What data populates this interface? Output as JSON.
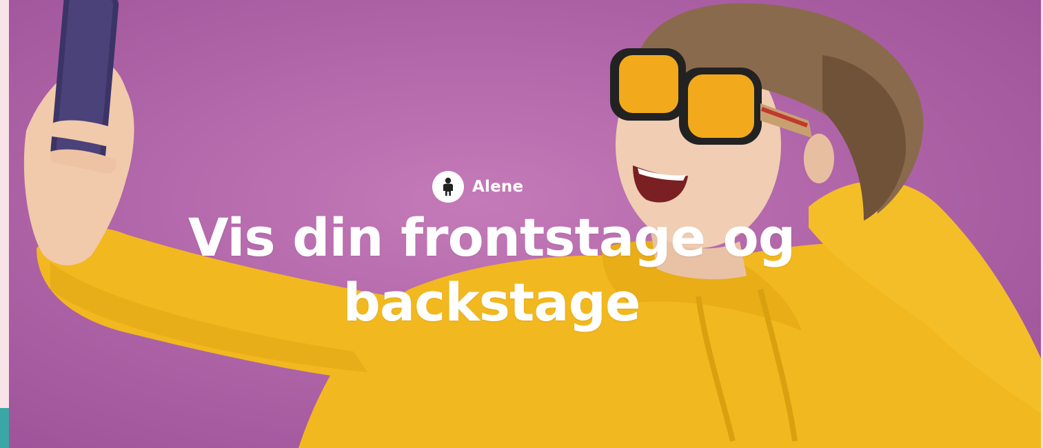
{
  "hero": {
    "category_label": "Alene",
    "category_icon": "person-icon",
    "headline": "Vis din frontstage og backstage"
  },
  "colors": {
    "background": "#b066a9",
    "hoodie": "#f2b81f",
    "text": "#ffffff",
    "accent_teal": "#3aa7a7"
  }
}
